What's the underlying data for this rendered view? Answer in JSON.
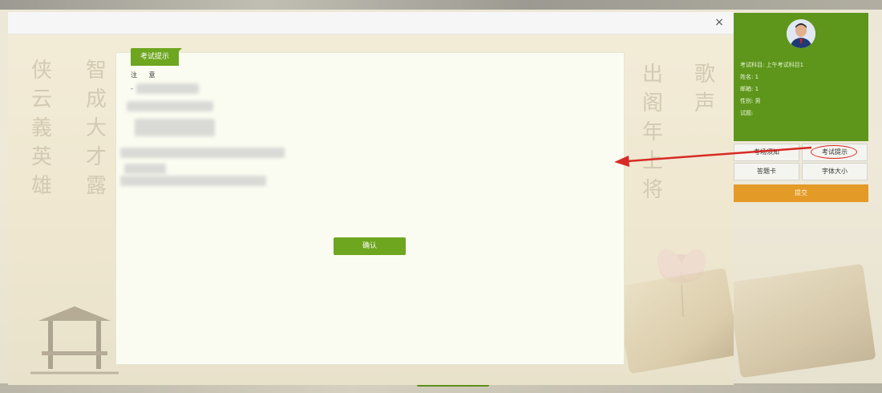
{
  "modal": {
    "close_glyph": "×",
    "tab_title": "考试提示",
    "notice_heading": "注 意",
    "notice_dash": "-",
    "confirm_label": "确认"
  },
  "background_calligraphy": {
    "left_columns": [
      "侠",
      "云",
      "義",
      "英",
      "雄",
      "智",
      "成",
      "大",
      "才",
      "露"
    ],
    "right_columns": [
      "出",
      "阁",
      "年",
      "上",
      "将",
      "歌",
      "声"
    ]
  },
  "side_panel": {
    "subject": "考试科目: 上午考试科目1",
    "name": "姓名: 1",
    "account": "邮箱: 1",
    "gender": "性别: 男",
    "question": "试题:"
  },
  "side_buttons": {
    "notice": "考场须知",
    "tips": "考试提示",
    "answer_card": "答题卡",
    "font_size": "字体大小",
    "submit": "提交"
  },
  "icons": {
    "close": "close-icon",
    "avatar": "user-avatar-icon",
    "arrow": "red-arrow-annotation"
  },
  "colors": {
    "accent_green": "#6ea61f",
    "panel_green": "#5e961b",
    "submit_orange": "#e39a27",
    "annotation_red": "#d82a25"
  }
}
